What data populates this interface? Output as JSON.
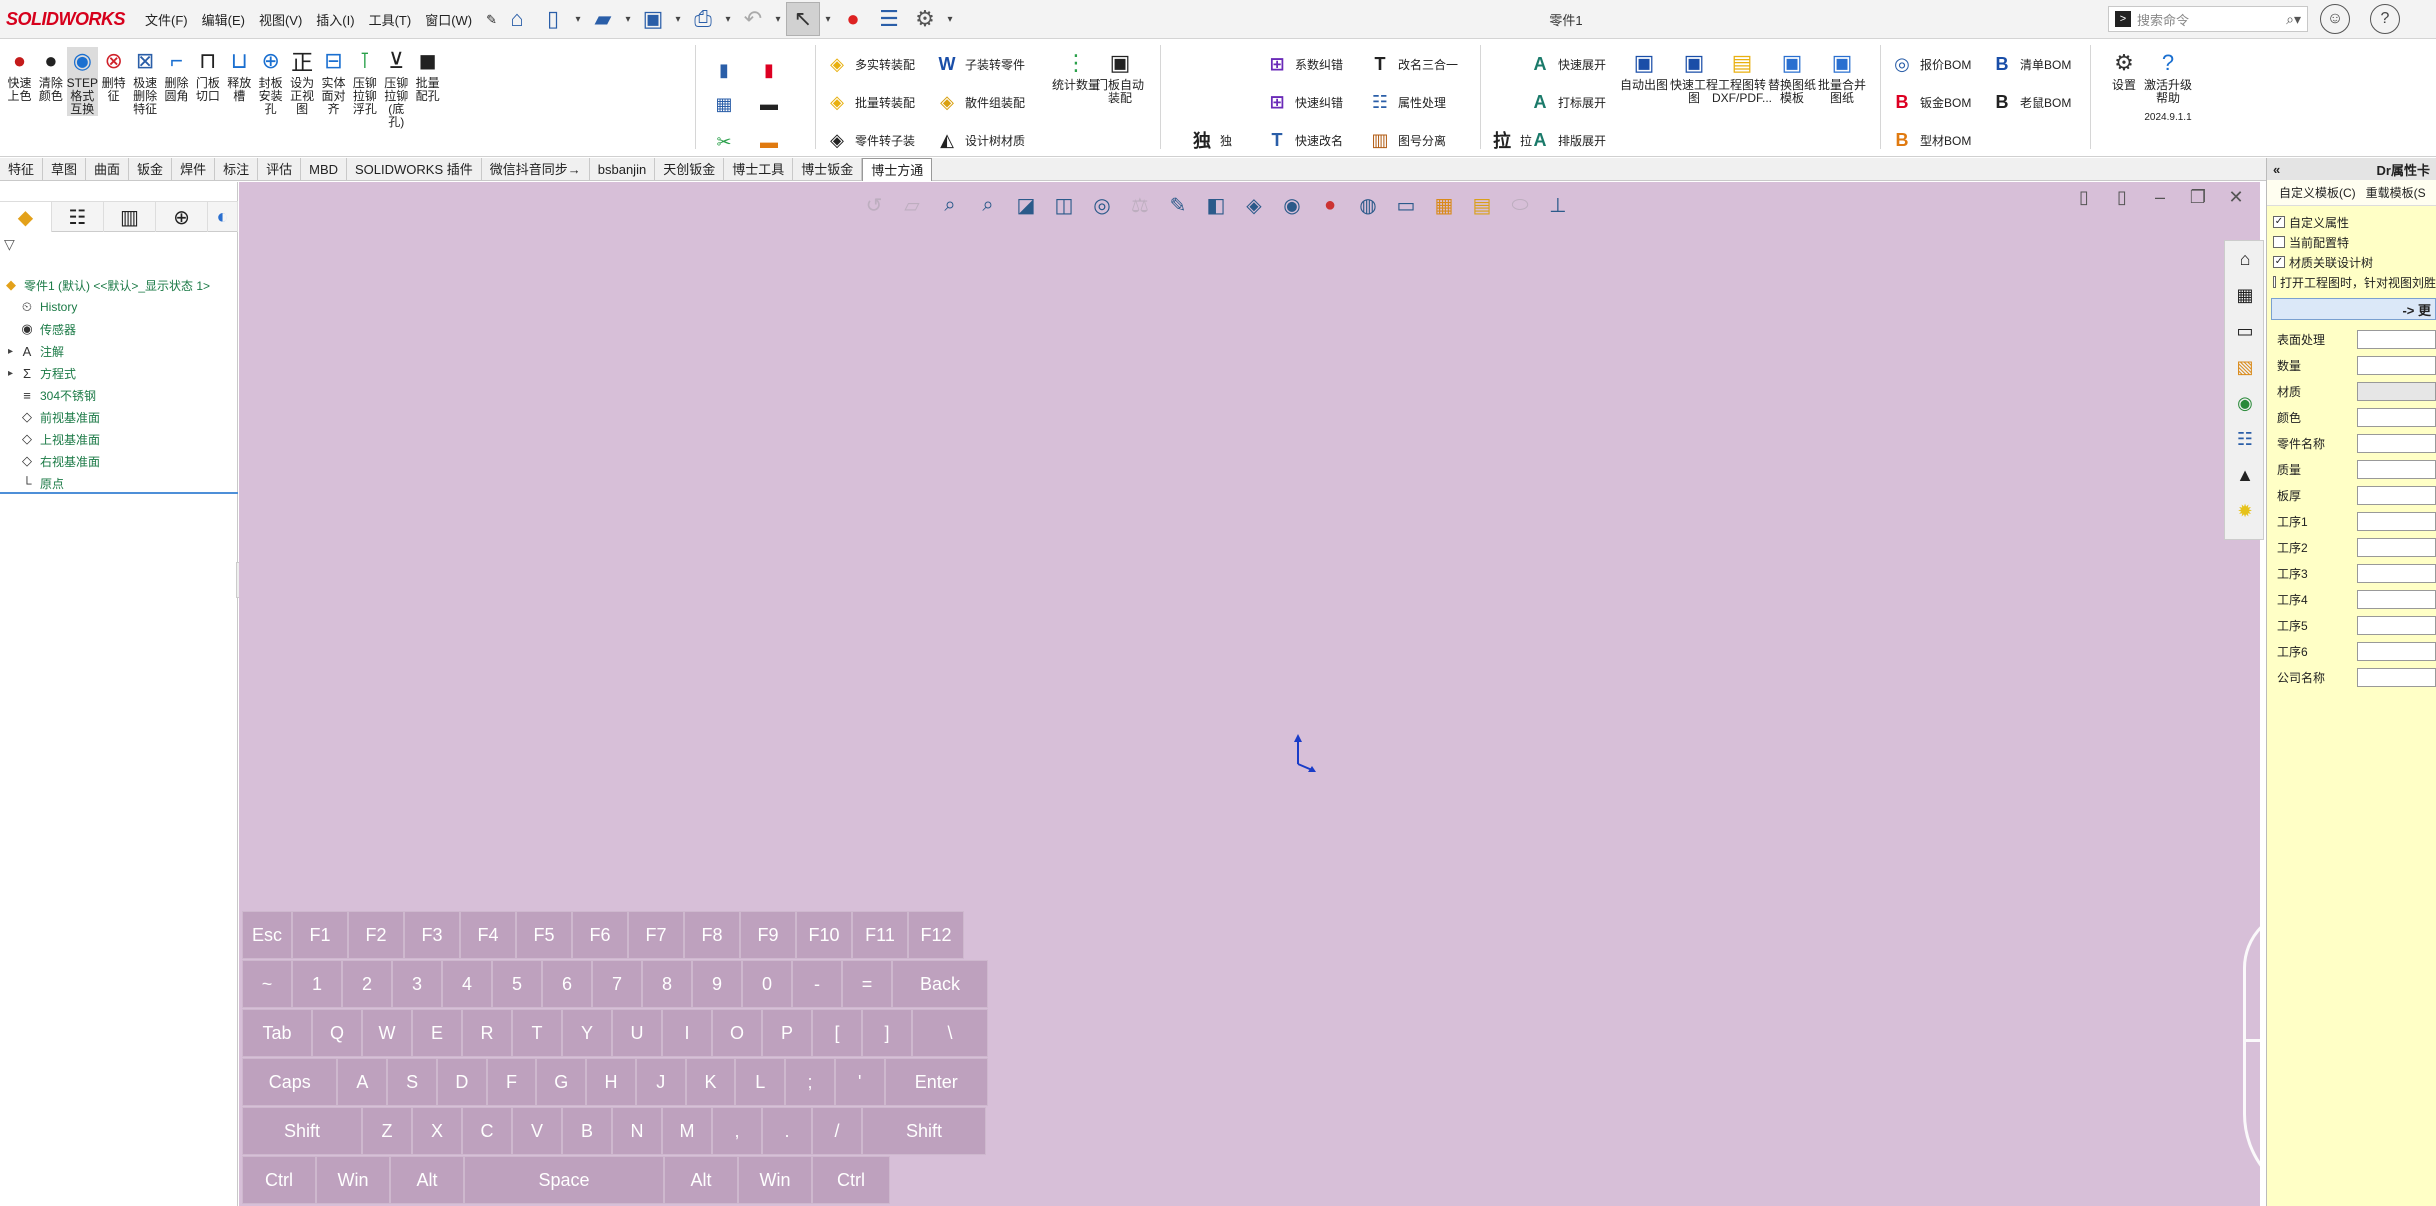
{
  "app": {
    "logo": "SOLIDWORKS",
    "doc_title": "零件1"
  },
  "menu": [
    "文件(F)",
    "编辑(E)",
    "视图(V)",
    "插入(I)",
    "工具(T)",
    "窗口(W)"
  ],
  "search": {
    "placeholder": "搜索命令"
  },
  "ribbon": {
    "large": [
      {
        "label": "快速上色",
        "icon": "palette-icon"
      },
      {
        "label": "清除颜色",
        "icon": "palette-clear-icon"
      },
      {
        "label": "STEP格式互换",
        "icon": "step-icon"
      },
      {
        "label": "删特征",
        "icon": "delete-icon"
      },
      {
        "label": "极速删除特征",
        "icon": "fast-delete-icon"
      },
      {
        "label": "删除圆角",
        "icon": "fillet-icon"
      },
      {
        "label": "门板切口",
        "icon": "door-cut-icon"
      },
      {
        "label": "释放槽",
        "icon": "relief-icon"
      },
      {
        "label": "封板安装孔",
        "icon": "hole-icon"
      },
      {
        "label": "设为正视图",
        "icon": "front-view-icon"
      },
      {
        "label": "实体面对齐",
        "icon": "align-icon"
      },
      {
        "label": "压铆拉铆浮孔",
        "icon": "rivet-icon"
      },
      {
        "label": "压铆拉铆(底孔)",
        "icon": "rivet-bottom-icon"
      },
      {
        "label": "批量配孔",
        "icon": "batch-hole-icon"
      }
    ],
    "small": [
      {
        "label": "多实转装配"
      },
      {
        "label": "批量转装配"
      },
      {
        "label": "零件转子装"
      },
      {
        "label": "子装转零件"
      },
      {
        "label": "散件组装配"
      },
      {
        "label": "设计树材质"
      },
      {
        "label": "统计数量"
      },
      {
        "label": "门板自动装配"
      },
      {
        "label": "系数纠错"
      },
      {
        "label": "快速纠错"
      },
      {
        "label": "快速改名"
      },
      {
        "label": "改名三合一"
      },
      {
        "label": "属性处理"
      },
      {
        "label": "图号分离"
      },
      {
        "label": "独"
      },
      {
        "label": "拉"
      },
      {
        "label": "快速展开"
      },
      {
        "label": "打标展开"
      },
      {
        "label": "排版展开"
      },
      {
        "label": "自动出图"
      },
      {
        "label": "快速工程图"
      },
      {
        "label": "工程图转DXF/PDF..."
      },
      {
        "label": "替换图纸模板"
      },
      {
        "label": "批量合并图纸"
      },
      {
        "label": "报价BOM"
      },
      {
        "label": "钣金BOM"
      },
      {
        "label": "型材BOM"
      },
      {
        "label": "清单BOM"
      },
      {
        "label": "老鼠BOM"
      },
      {
        "label": "设置"
      },
      {
        "label": "激活升级帮助"
      },
      {
        "label": "2024.9.1.1"
      }
    ]
  },
  "tabs": [
    "特征",
    "草图",
    "曲面",
    "钣金",
    "焊件",
    "标注",
    "评估",
    "MBD",
    "SOLIDWORKS 插件",
    "微信抖音同步→",
    "bsbanjin",
    "天创钣金",
    "博士工具",
    "博士钣金",
    "博士方通"
  ],
  "active_tab": "博士方通",
  "tree": [
    {
      "label": "零件1 (默认) <<默认>_显示状态 1>",
      "icon": "part-icon",
      "exp": ""
    },
    {
      "label": "History",
      "icon": "history-icon",
      "exp": ""
    },
    {
      "label": "传感器",
      "icon": "sensor-icon",
      "exp": ""
    },
    {
      "label": "注解",
      "icon": "annotation-icon",
      "exp": "▸"
    },
    {
      "label": "方程式",
      "icon": "equation-icon",
      "exp": "▸"
    },
    {
      "label": "304不锈钢",
      "icon": "material-icon",
      "exp": ""
    },
    {
      "label": "前视基准面",
      "icon": "plane-icon",
      "exp": ""
    },
    {
      "label": "上视基准面",
      "icon": "plane-icon",
      "exp": ""
    },
    {
      "label": "右视基准面",
      "icon": "plane-icon",
      "exp": ""
    },
    {
      "label": "原点",
      "icon": "origin-icon",
      "exp": ""
    }
  ],
  "keyboard": [
    [
      "Esc",
      "F1",
      "F2",
      "F3",
      "F4",
      "F5",
      "F6",
      "F7",
      "F8",
      "F9",
      "F10",
      "F11",
      "F12"
    ],
    [
      "~",
      "1",
      "2",
      "3",
      "4",
      "5",
      "6",
      "7",
      "8",
      "9",
      "0",
      "-",
      "=",
      "Back"
    ],
    [
      "Tab",
      "Q",
      "W",
      "E",
      "R",
      "T",
      "Y",
      "U",
      "I",
      "O",
      "P",
      "[",
      "]",
      "\\"
    ],
    [
      "Caps",
      "A",
      "S",
      "D",
      "F",
      "G",
      "H",
      "J",
      "K",
      "L",
      ";",
      "'",
      "Enter"
    ],
    [
      "Shift",
      "Z",
      "X",
      "C",
      "V",
      "B",
      "N",
      "M",
      ",",
      ".",
      "/",
      "Shift"
    ],
    [
      "Ctrl",
      "Win",
      "Alt",
      "Space",
      "Alt",
      "Win",
      "Ctrl"
    ]
  ],
  "right_panel": {
    "title": "Dr属性卡",
    "sub": [
      "自定义模板(C)",
      "重载模板(S"
    ],
    "checks": [
      {
        "label": "自定义属性",
        "on": true
      },
      {
        "label": "当前配置特",
        "on": false
      },
      {
        "label": "材质关联设计树",
        "on": true
      },
      {
        "label": "打开工程图时，针对视图刘胜",
        "on": false
      }
    ],
    "button": "-> 更",
    "fields": [
      "表面处理",
      "数量",
      "材质",
      "颜色",
      "零件名称",
      "质量",
      "板厚",
      "工序1",
      "工序2",
      "工序3",
      "工序4",
      "工序5",
      "工序6",
      "公司名称"
    ]
  }
}
